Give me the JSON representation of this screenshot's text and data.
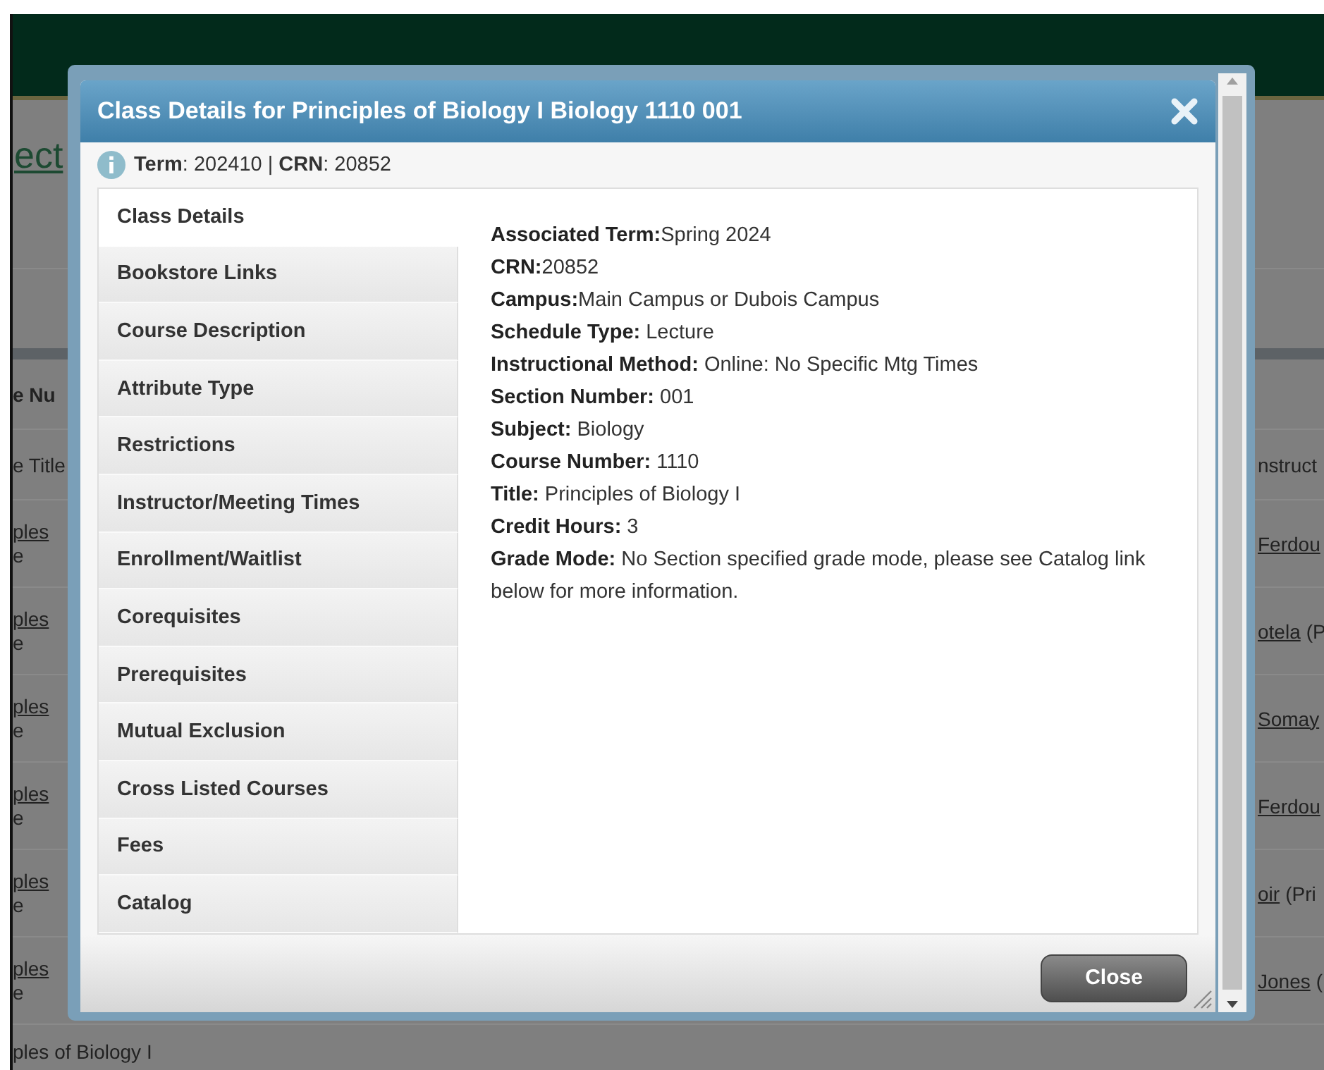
{
  "background": {
    "link": "ect",
    "column_headers": [
      "e Nu",
      "e Title",
      "nstruct"
    ],
    "rows": [
      {
        "left": [
          "ples",
          "e"
        ],
        "right_link": "Ferdou"
      },
      {
        "left": [
          "ples",
          "e"
        ],
        "right_link": "otela",
        "right_rest": "(P"
      },
      {
        "left": [
          "ples",
          "e"
        ],
        "right_link": "Somay"
      },
      {
        "left": [
          "ples",
          "e"
        ],
        "right_link": "Ferdou"
      },
      {
        "left": [
          "ples",
          "e"
        ],
        "right_link": "oir",
        "right_rest": "(Pri"
      },
      {
        "left": [
          "ples",
          "e"
        ],
        "right_link": "Jones",
        "right_rest": "("
      }
    ],
    "last_row": "ples of Biology I"
  },
  "dialog": {
    "title": "Class Details for Principles of Biology I Biology 1110 001",
    "info": "**Term**: 202410 | **CRN**: 20852",
    "tabs": [
      {
        "label": "Class Details",
        "selected": true
      },
      {
        "label": "Bookstore Links",
        "selected": false
      },
      {
        "label": "Course Description",
        "selected": false
      },
      {
        "label": "Attribute Type",
        "selected": false
      },
      {
        "label": "Restrictions",
        "selected": false
      },
      {
        "label": "Instructor/Meeting Times",
        "selected": false
      },
      {
        "label": "Enrollment/Waitlist",
        "selected": false
      },
      {
        "label": "Corequisites",
        "selected": false
      },
      {
        "label": "Prerequisites",
        "selected": false
      },
      {
        "label": "Mutual Exclusion",
        "selected": false
      },
      {
        "label": "Cross Listed Courses",
        "selected": false
      },
      {
        "label": "Fees",
        "selected": false
      },
      {
        "label": "Catalog",
        "selected": false
      }
    ],
    "details": [
      "**Associated Term:**Spring 2024",
      "**CRN:**20852",
      "**Campus:**Main Campus or Dubois Campus",
      "**Schedule Type:** Lecture",
      "**Instructional Method:** Online: No Specific Mtg Times",
      "**Section Number:** 001",
      "**Subject:** Biology",
      "**Course Number:** 1110",
      "**Title:** Principles of Biology I",
      "**Credit Hours:** 3",
      "**Grade Mode:** No Section specified grade mode, please see Catalog link below for more information."
    ],
    "close_button": "Close"
  }
}
